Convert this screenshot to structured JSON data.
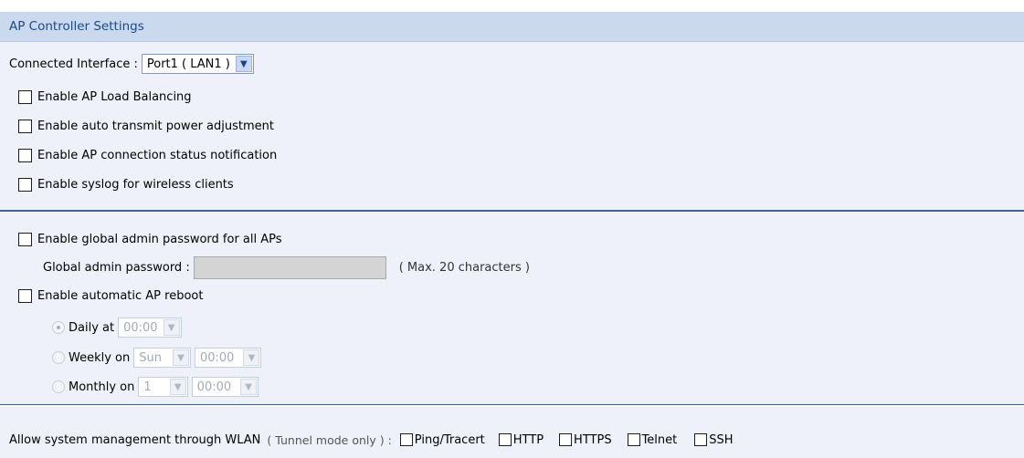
{
  "header": {
    "title": "AP Controller Settings"
  },
  "interface": {
    "label": "Connected Interface :",
    "value": "Port1 ( LAN1 )",
    "arrow_icon": "chevron-down-icon"
  },
  "section1": {
    "checkboxes": [
      {
        "label": "Enable AP Load Balancing",
        "checked": false
      },
      {
        "label": "Enable auto transmit power adjustment",
        "checked": false
      },
      {
        "label": "Enable AP connection status notification",
        "checked": false
      },
      {
        "label": "Enable syslog for wireless clients",
        "checked": false
      }
    ]
  },
  "section2": {
    "global_pwd_checkbox": "Enable global admin password for all APs",
    "global_pwd_label": "Global admin password :",
    "global_pwd_hint": "( Max. 20 characters )",
    "reboot_checkbox": "Enable automatic AP reboot",
    "daily": {
      "label": "Daily at",
      "time": "00:00",
      "selected": true
    },
    "weekly": {
      "label": "Weekly on",
      "day": "Sun",
      "time": "00:00",
      "selected": false
    },
    "monthly": {
      "label": "Monthly on",
      "day": "1",
      "time": "00:00",
      "selected": false
    }
  },
  "section3": {
    "label": "Allow system management through WLAN",
    "note": "( Tunnel mode only ) :",
    "options": [
      "Ping/Tracert",
      "HTTP",
      "HTTPS",
      "Telnet",
      "SSH"
    ]
  },
  "colors": {
    "header_bg": "#cbd9ee",
    "header_text": "#1a4a8a",
    "panel_bg": "#eef1f9",
    "divider": "#3f5f92"
  }
}
